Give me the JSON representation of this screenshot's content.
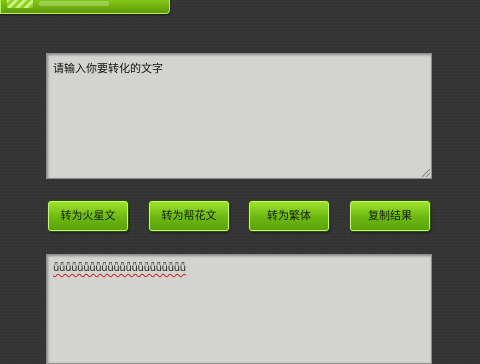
{
  "input": {
    "text": "请输入你要转化的文字"
  },
  "buttons": {
    "huoxing": "转为火星文",
    "banghua": "转为帮花文",
    "fanti": "转为繁体",
    "copy": "复制结果"
  },
  "output": {
    "text": "ǖǖǖǖǖǖǖǖǖǖǖǖǖǖǖǖǖǖǖǖǖǖ"
  }
}
